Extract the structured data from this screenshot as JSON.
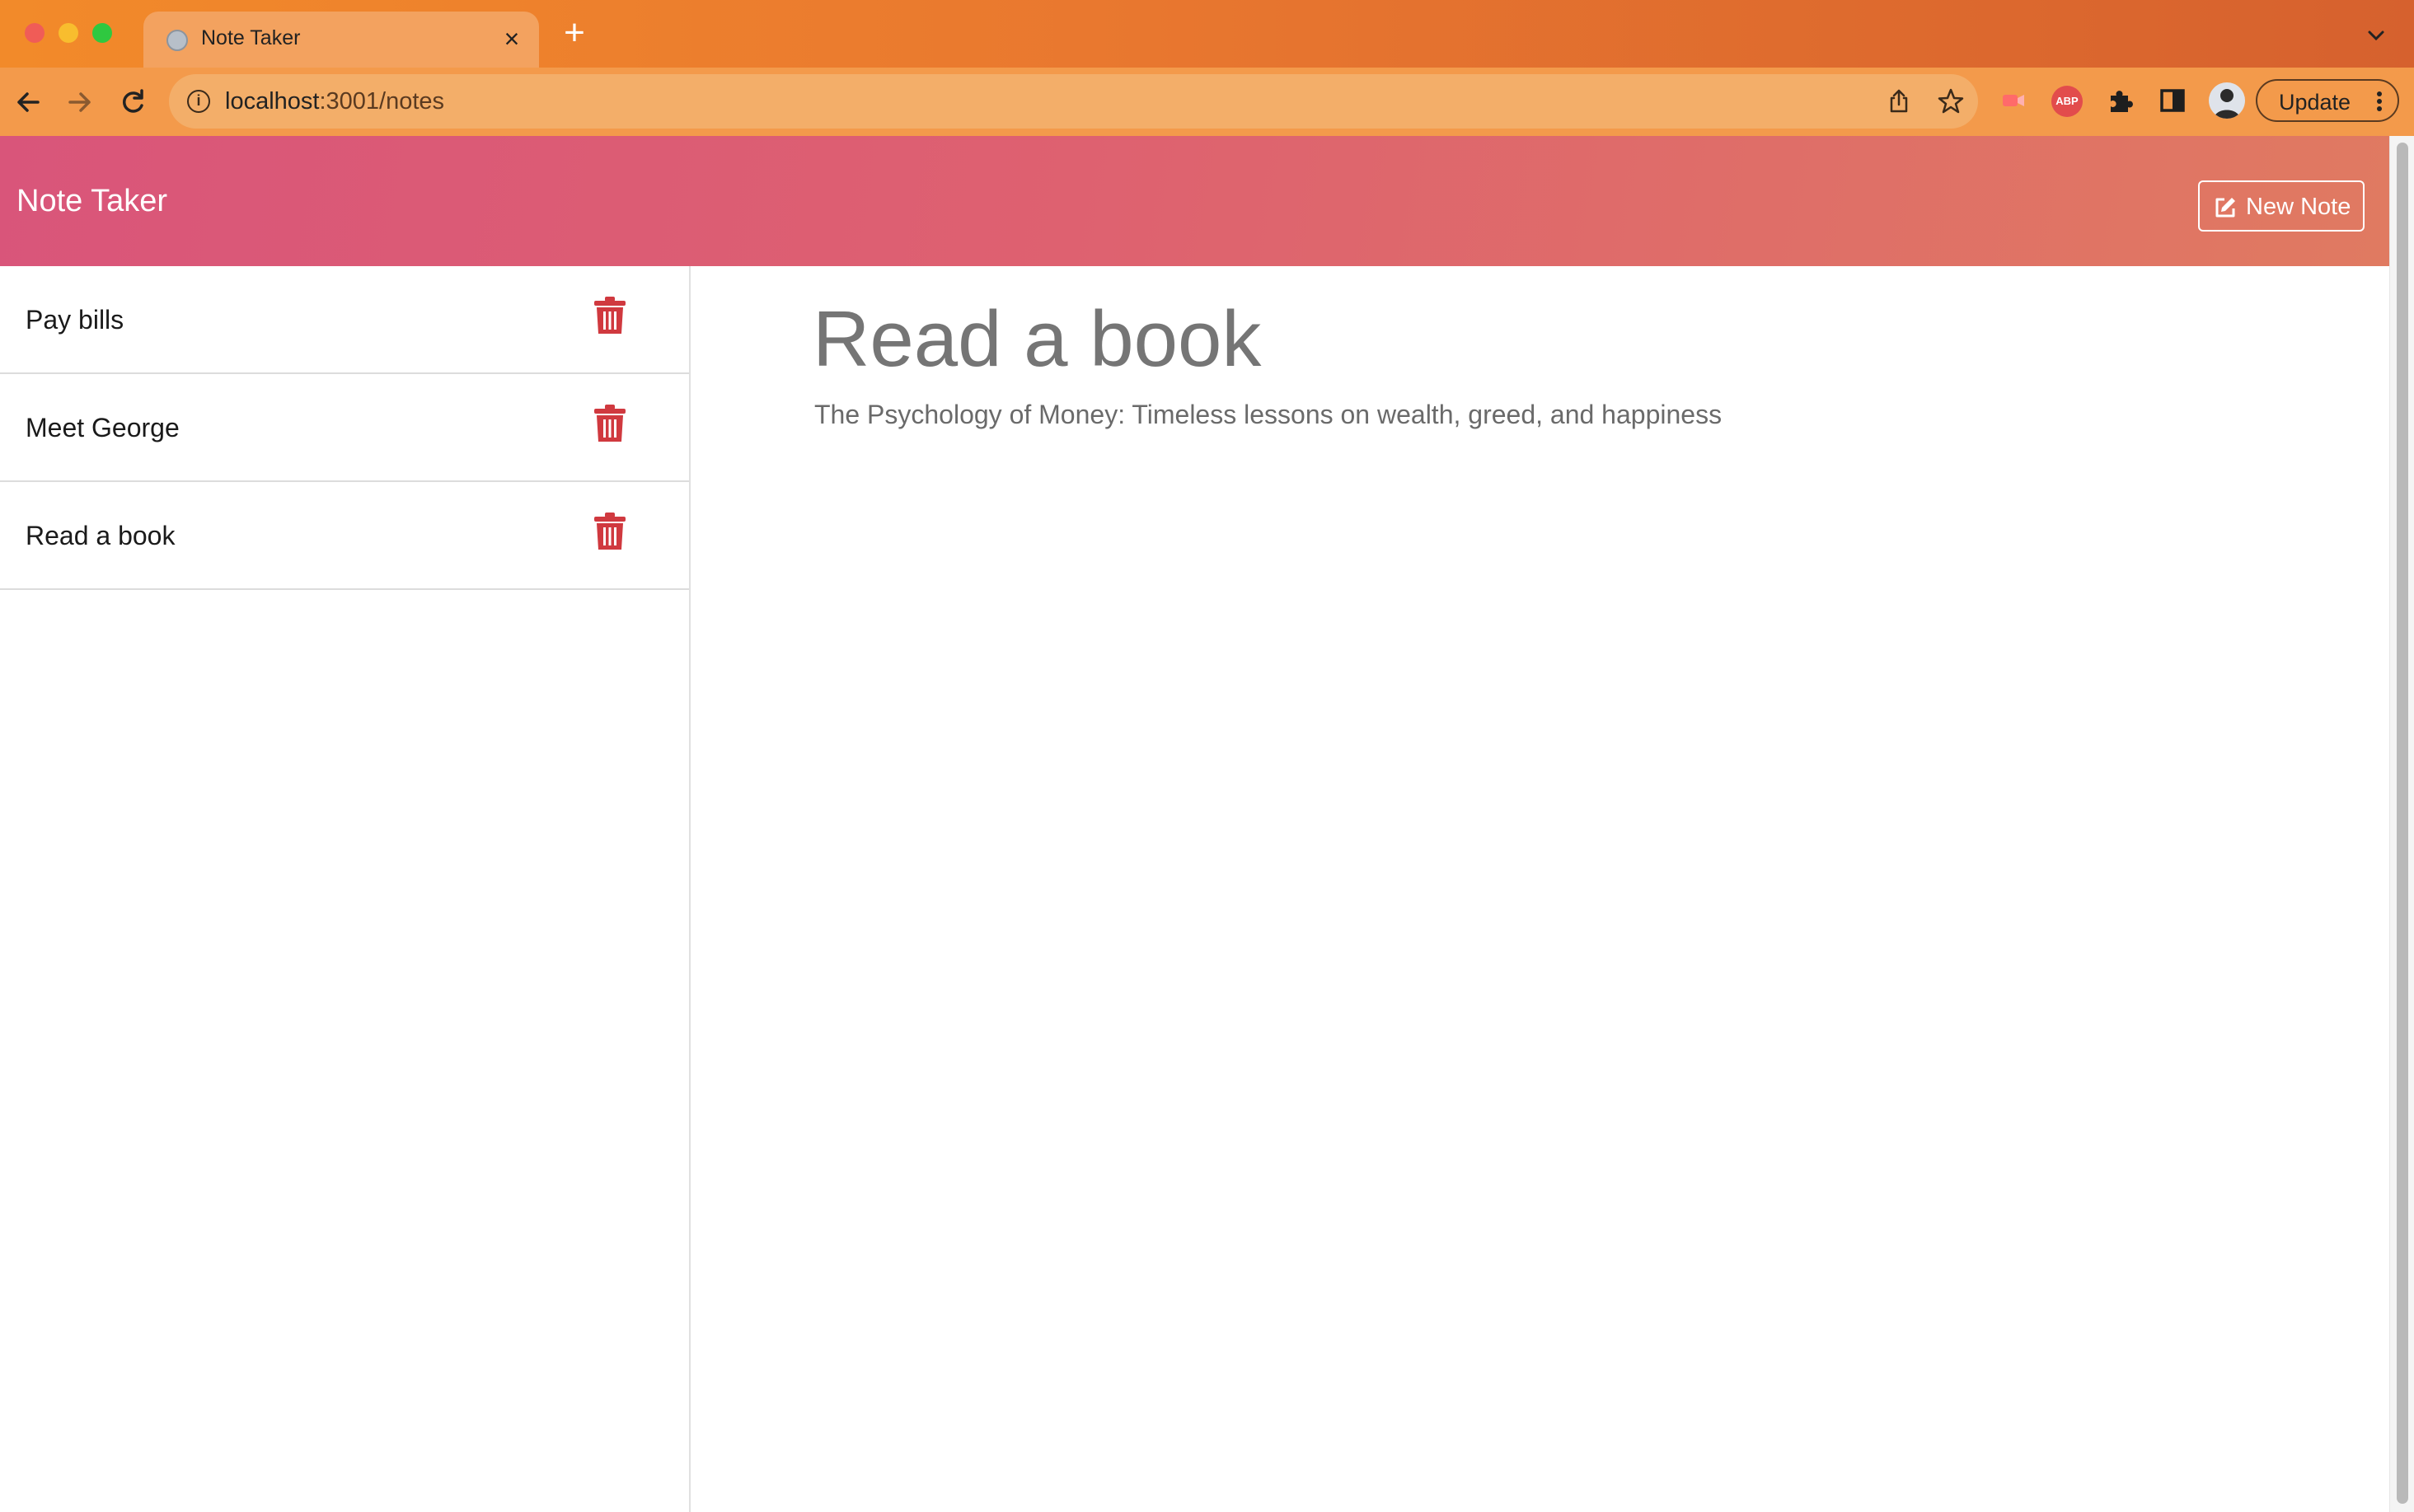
{
  "browser": {
    "tab_title": "Note Taker",
    "url_host": "localhost",
    "url_path": ":3001/notes",
    "update_label": "Update"
  },
  "app": {
    "brand": "Note Taker",
    "new_note_label": "New Note"
  },
  "notes": [
    {
      "title": "Pay bills"
    },
    {
      "title": "Meet George"
    },
    {
      "title": "Read a book"
    }
  ],
  "active_note": {
    "title": "Read a book",
    "text": "The Psychology of Money: Timeless lessons on wealth, greed, and happiness"
  },
  "colors": {
    "header_start": "#d9557a",
    "header_end": "#e07a61",
    "trash": "#d0393f",
    "chrome_orange": "#f28a2a"
  }
}
